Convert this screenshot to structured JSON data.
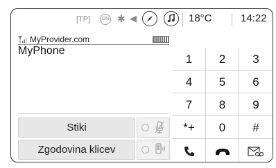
{
  "status": {
    "tp": "[TP]",
    "on_label": "ON",
    "temperature": "18°C",
    "time": "14:22"
  },
  "phone": {
    "provider": "MyProvider.com",
    "device_name": "MyPhone"
  },
  "buttons": {
    "contacts": "Stiki",
    "call_history": "Zgodovina klicev"
  },
  "keypad": {
    "keys": [
      "1",
      "2",
      "3",
      "4",
      "5",
      "6",
      "7",
      "8",
      "9",
      "*+",
      "0",
      "#"
    ]
  },
  "icons": {
    "bluetooth": "bluetooth-icon",
    "volume": "volume-icon",
    "navigation": "compass-icon",
    "music": "music-note-icon",
    "mute_mic": "microphone-muted-icon",
    "handsfree": "phone-handset-speaker-icon",
    "call": "phone-call-icon",
    "hangup": "phone-hangup-icon",
    "voicemail": "voicemail-icon"
  }
}
